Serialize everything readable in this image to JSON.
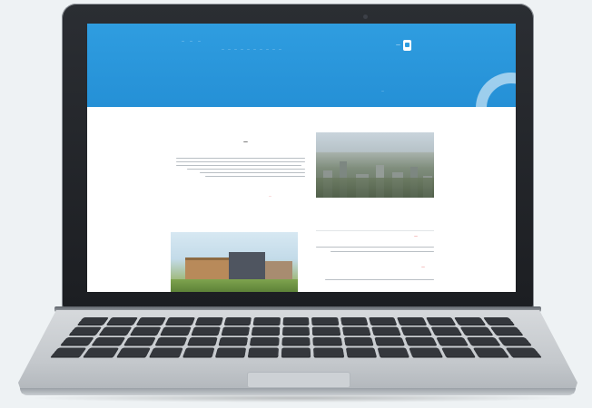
{
  "site": {
    "logo_icon": "building-logo-icon",
    "logo_text": "—",
    "top_links": [
      "—",
      "—",
      "—"
    ],
    "nav_items": [
      "—",
      "—",
      "—",
      "—",
      "—",
      "—",
      "—",
      "—",
      "—",
      "—"
    ],
    "tagline": "—"
  },
  "article": {
    "title": "—",
    "read_more": "—"
  },
  "sidebar": {
    "section_one": "—",
    "section_two": "—"
  },
  "colors": {
    "header_blue": "#2f9de0",
    "accent_red": "#e24a4a",
    "bezel": "#1c1e22"
  }
}
